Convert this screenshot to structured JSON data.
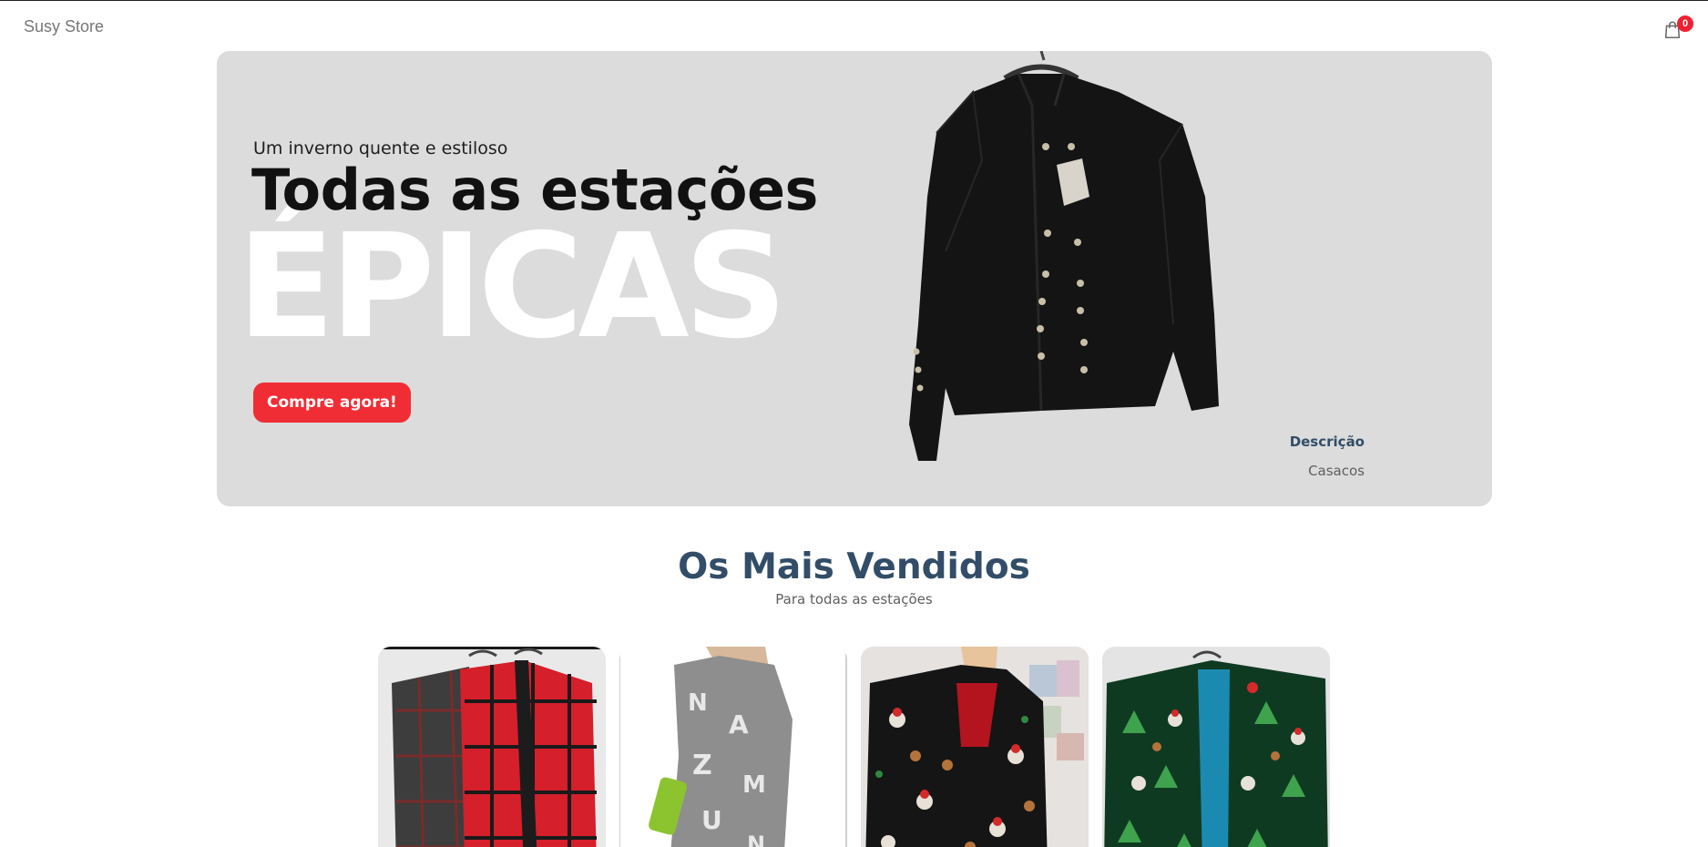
{
  "navbar": {
    "logo": "Susy Store",
    "cart_count": "0"
  },
  "hero": {
    "small_text": "Um inverno quente e estiloso",
    "mid_text": "Todas as estações",
    "large_text": "ÉPICAS",
    "button_label": "Compre agora!",
    "description_title": "Descrição",
    "description_text": "Casacos",
    "background_color": "#dcdcdc",
    "button_color": "#f02d34"
  },
  "section": {
    "title": "Os Mais Vendidos",
    "subtitle": "Para todas as estações"
  },
  "products": [
    {
      "image": "plaid-blazers"
    },
    {
      "image": "letter-print-dress"
    },
    {
      "image": "christmas-print-blazer"
    },
    {
      "image": "christmas-tree-blazers"
    }
  ],
  "colors": {
    "accent": "#f02d34",
    "heading": "#324d67",
    "muted": "#5f5f5f"
  }
}
